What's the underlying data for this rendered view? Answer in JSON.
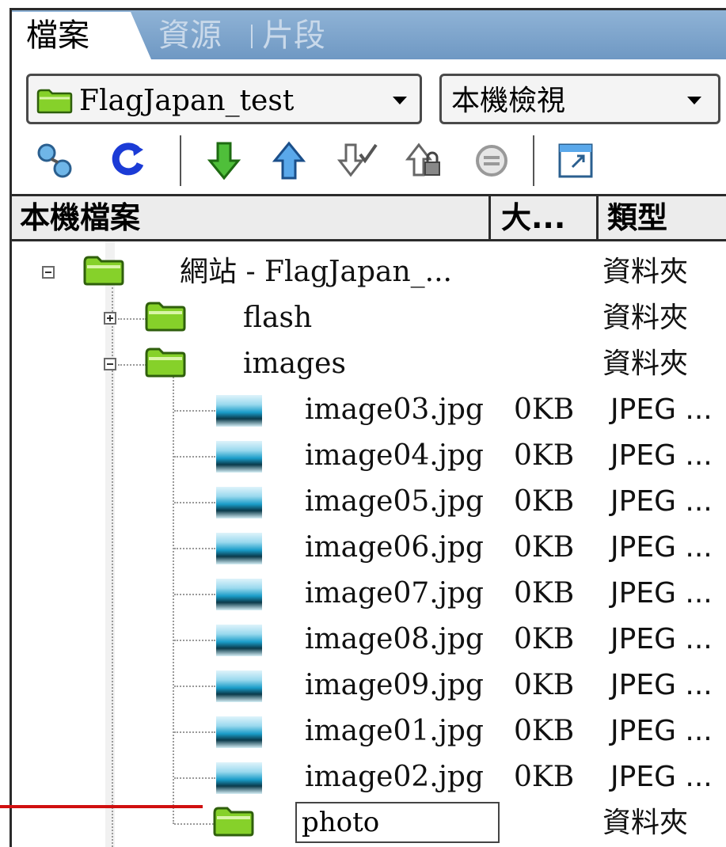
{
  "tabs": [
    {
      "label": "檔案",
      "active": true
    },
    {
      "label": "資源",
      "active": false
    },
    {
      "label": "片段",
      "active": false
    }
  ],
  "site_select": {
    "value": "FlagJapan_test"
  },
  "view_select": {
    "value": "本機檢視"
  },
  "toolbar": {
    "buttons": [
      "connect-icon",
      "refresh-icon",
      "get-icon",
      "put-icon",
      "check-out-icon",
      "check-in-icon",
      "sync-icon",
      "expand-icon"
    ]
  },
  "columns": {
    "name": "本機檔案",
    "size": "大...",
    "type": "類型"
  },
  "tree": {
    "root": {
      "name": "網站 - FlagJapan_...",
      "type": "資料夾"
    },
    "folders": [
      {
        "name": "flash",
        "type": "資料夾"
      },
      {
        "name": "images",
        "type": "資料夾"
      }
    ],
    "files": [
      {
        "name": "image03.jpg",
        "size": "0KB",
        "type": "JPEG ..."
      },
      {
        "name": "image04.jpg",
        "size": "0KB",
        "type": "JPEG ..."
      },
      {
        "name": "image05.jpg",
        "size": "0KB",
        "type": "JPEG ..."
      },
      {
        "name": "image06.jpg",
        "size": "0KB",
        "type": "JPEG ..."
      },
      {
        "name": "image07.jpg",
        "size": "0KB",
        "type": "JPEG ..."
      },
      {
        "name": "image08.jpg",
        "size": "0KB",
        "type": "JPEG ..."
      },
      {
        "name": "image09.jpg",
        "size": "0KB",
        "type": "JPEG ..."
      },
      {
        "name": "image01.jpg",
        "size": "0KB",
        "type": "JPEG ..."
      },
      {
        "name": "image02.jpg",
        "size": "0KB",
        "type": "JPEG ..."
      }
    ],
    "new_folder": {
      "name": "photo",
      "type": "資料夾"
    }
  },
  "colors": {
    "tab_strip": "#7ea6cd",
    "folder": "#7fcf1f",
    "annotation_line": "#d01010"
  }
}
